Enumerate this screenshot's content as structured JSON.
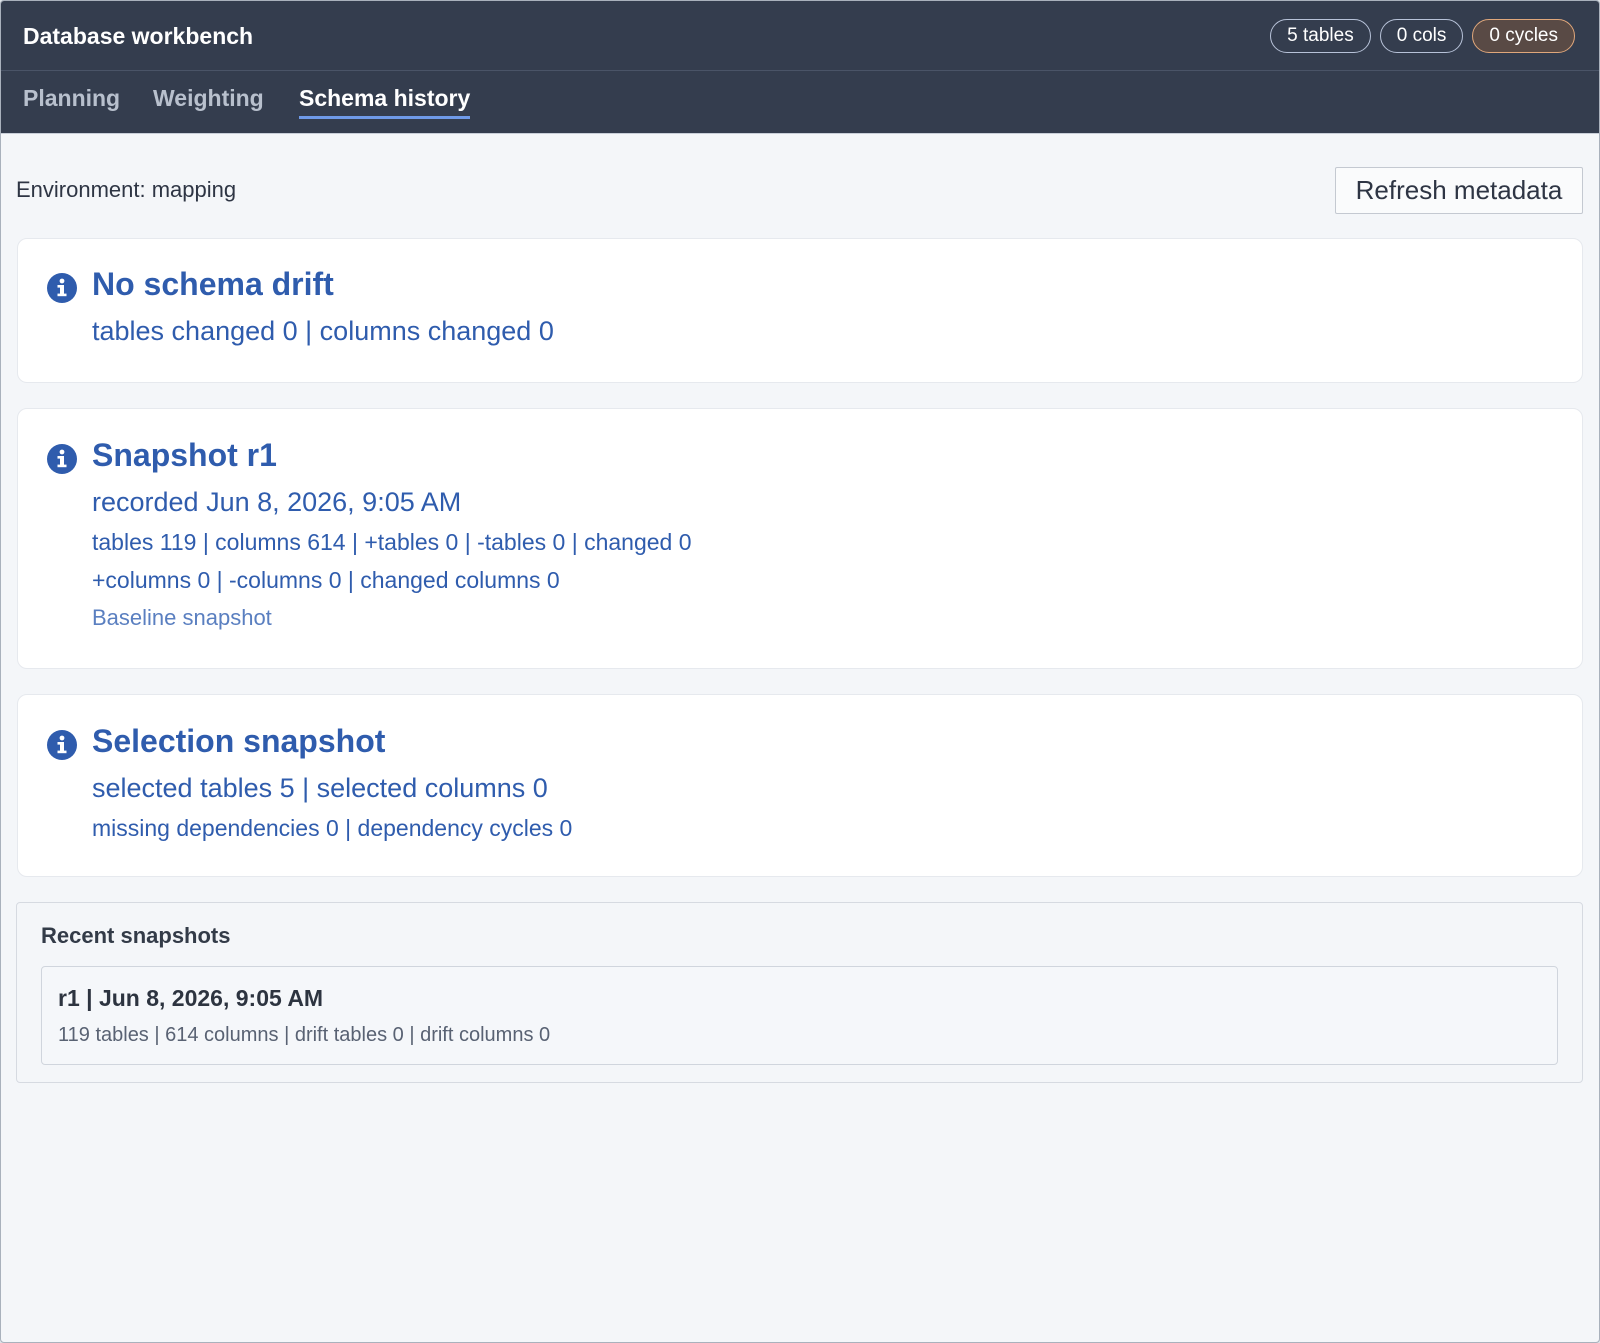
{
  "app": {
    "title": "Database workbench"
  },
  "header": {
    "pills": {
      "tables": "5 tables",
      "cols": "0 cols",
      "cycles": "0 cycles"
    }
  },
  "tabs": [
    {
      "label": "Planning",
      "active": false
    },
    {
      "label": "Weighting",
      "active": false
    },
    {
      "label": "Schema history",
      "active": true
    }
  ],
  "environment": {
    "label": "Environment: mapping"
  },
  "toolbar": {
    "refresh_label": "Refresh metadata"
  },
  "cards": {
    "drift": {
      "icon": "info-icon",
      "title": "No schema drift",
      "summary": "tables changed 0 | columns changed 0"
    },
    "snapshot": {
      "icon": "info-icon",
      "title": "Snapshot r1",
      "recorded": "recorded Jun 8, 2026, 9:05 AM",
      "stats_line1": "tables 119 | columns 614 | +tables 0 | -tables 0 | changed 0",
      "stats_line2": "+columns 0 | -columns 0 | changed columns 0",
      "note": "Baseline snapshot"
    },
    "selection": {
      "icon": "info-icon",
      "title": "Selection snapshot",
      "summary": "selected tables 5 | selected columns 0",
      "dependencies": "missing dependencies 0 | dependency cycles 0"
    }
  },
  "recent": {
    "title": "Recent snapshots",
    "items": [
      {
        "head": "r1 | Jun 8, 2026, 9:05 AM",
        "meta": "119 tables | 614 columns | drift tables 0 | drift columns 0"
      }
    ]
  },
  "colors": {
    "header_bg": "#343d4e",
    "accent": "#6f9ae8",
    "info_blue": "#2f5cad",
    "warn_border": "#e0a77b"
  }
}
